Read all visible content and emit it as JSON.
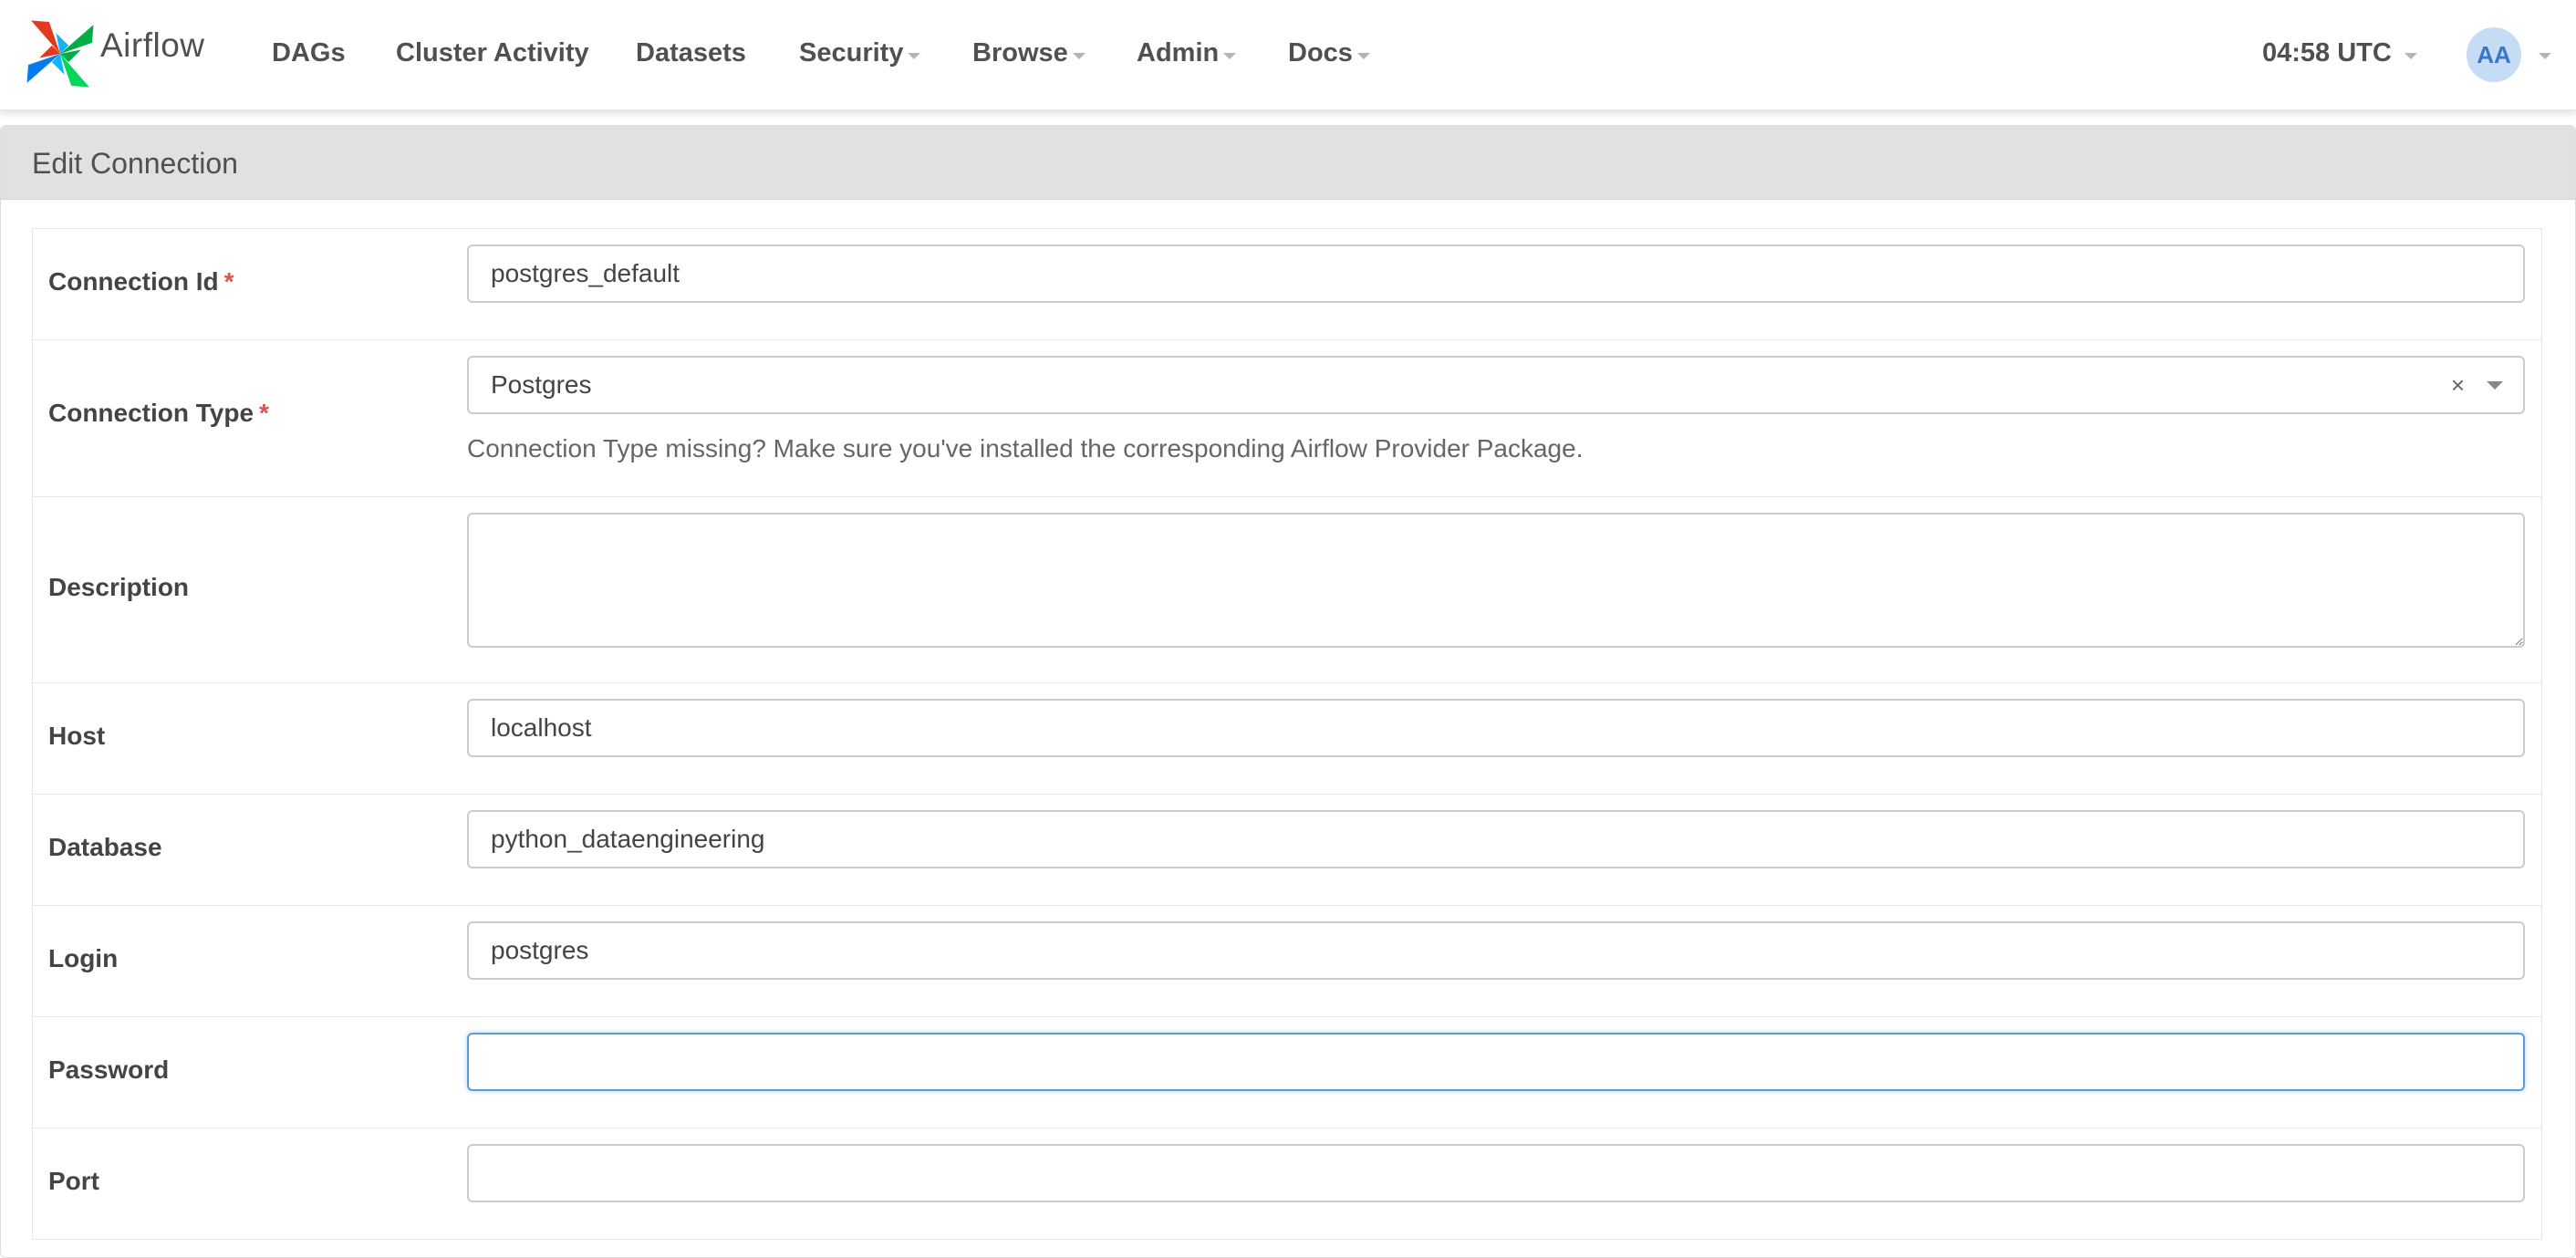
{
  "navbar": {
    "brand": "Airflow",
    "items": [
      {
        "label": "DAGs",
        "dropdown": false
      },
      {
        "label": "Cluster Activity",
        "dropdown": false
      },
      {
        "label": "Datasets",
        "dropdown": false
      },
      {
        "label": "Security",
        "dropdown": true
      },
      {
        "label": "Browse",
        "dropdown": true
      },
      {
        "label": "Admin",
        "dropdown": true
      },
      {
        "label": "Docs",
        "dropdown": true
      }
    ],
    "clock": "04:58 UTC",
    "user_initials": "AA"
  },
  "panel": {
    "title": "Edit Connection"
  },
  "form": {
    "connection_id": {
      "label": "Connection Id",
      "required_marker": "*",
      "value": "postgres_default"
    },
    "connection_type": {
      "label": "Connection Type",
      "required_marker": "*",
      "value": "Postgres",
      "clear_symbol": "×",
      "help": "Connection Type missing? Make sure you've installed the corresponding Airflow Provider Package."
    },
    "description": {
      "label": "Description",
      "value": ""
    },
    "host": {
      "label": "Host",
      "value": "localhost"
    },
    "database": {
      "label": "Database",
      "value": "python_dataengineering"
    },
    "login": {
      "label": "Login",
      "value": "postgres"
    },
    "password": {
      "label": "Password",
      "value": ""
    },
    "port": {
      "label": "Port",
      "value": ""
    }
  },
  "colors": {
    "brand_text": "#51504f",
    "required": "#d9534f",
    "focus_border": "#5b9be0",
    "avatar_bg": "#c6dcf5",
    "avatar_text": "#3b77c9"
  },
  "icons": {
    "logo": "airflow-pinwheel-icon",
    "dropdown": "caret-down-icon",
    "clear": "clear-icon"
  }
}
